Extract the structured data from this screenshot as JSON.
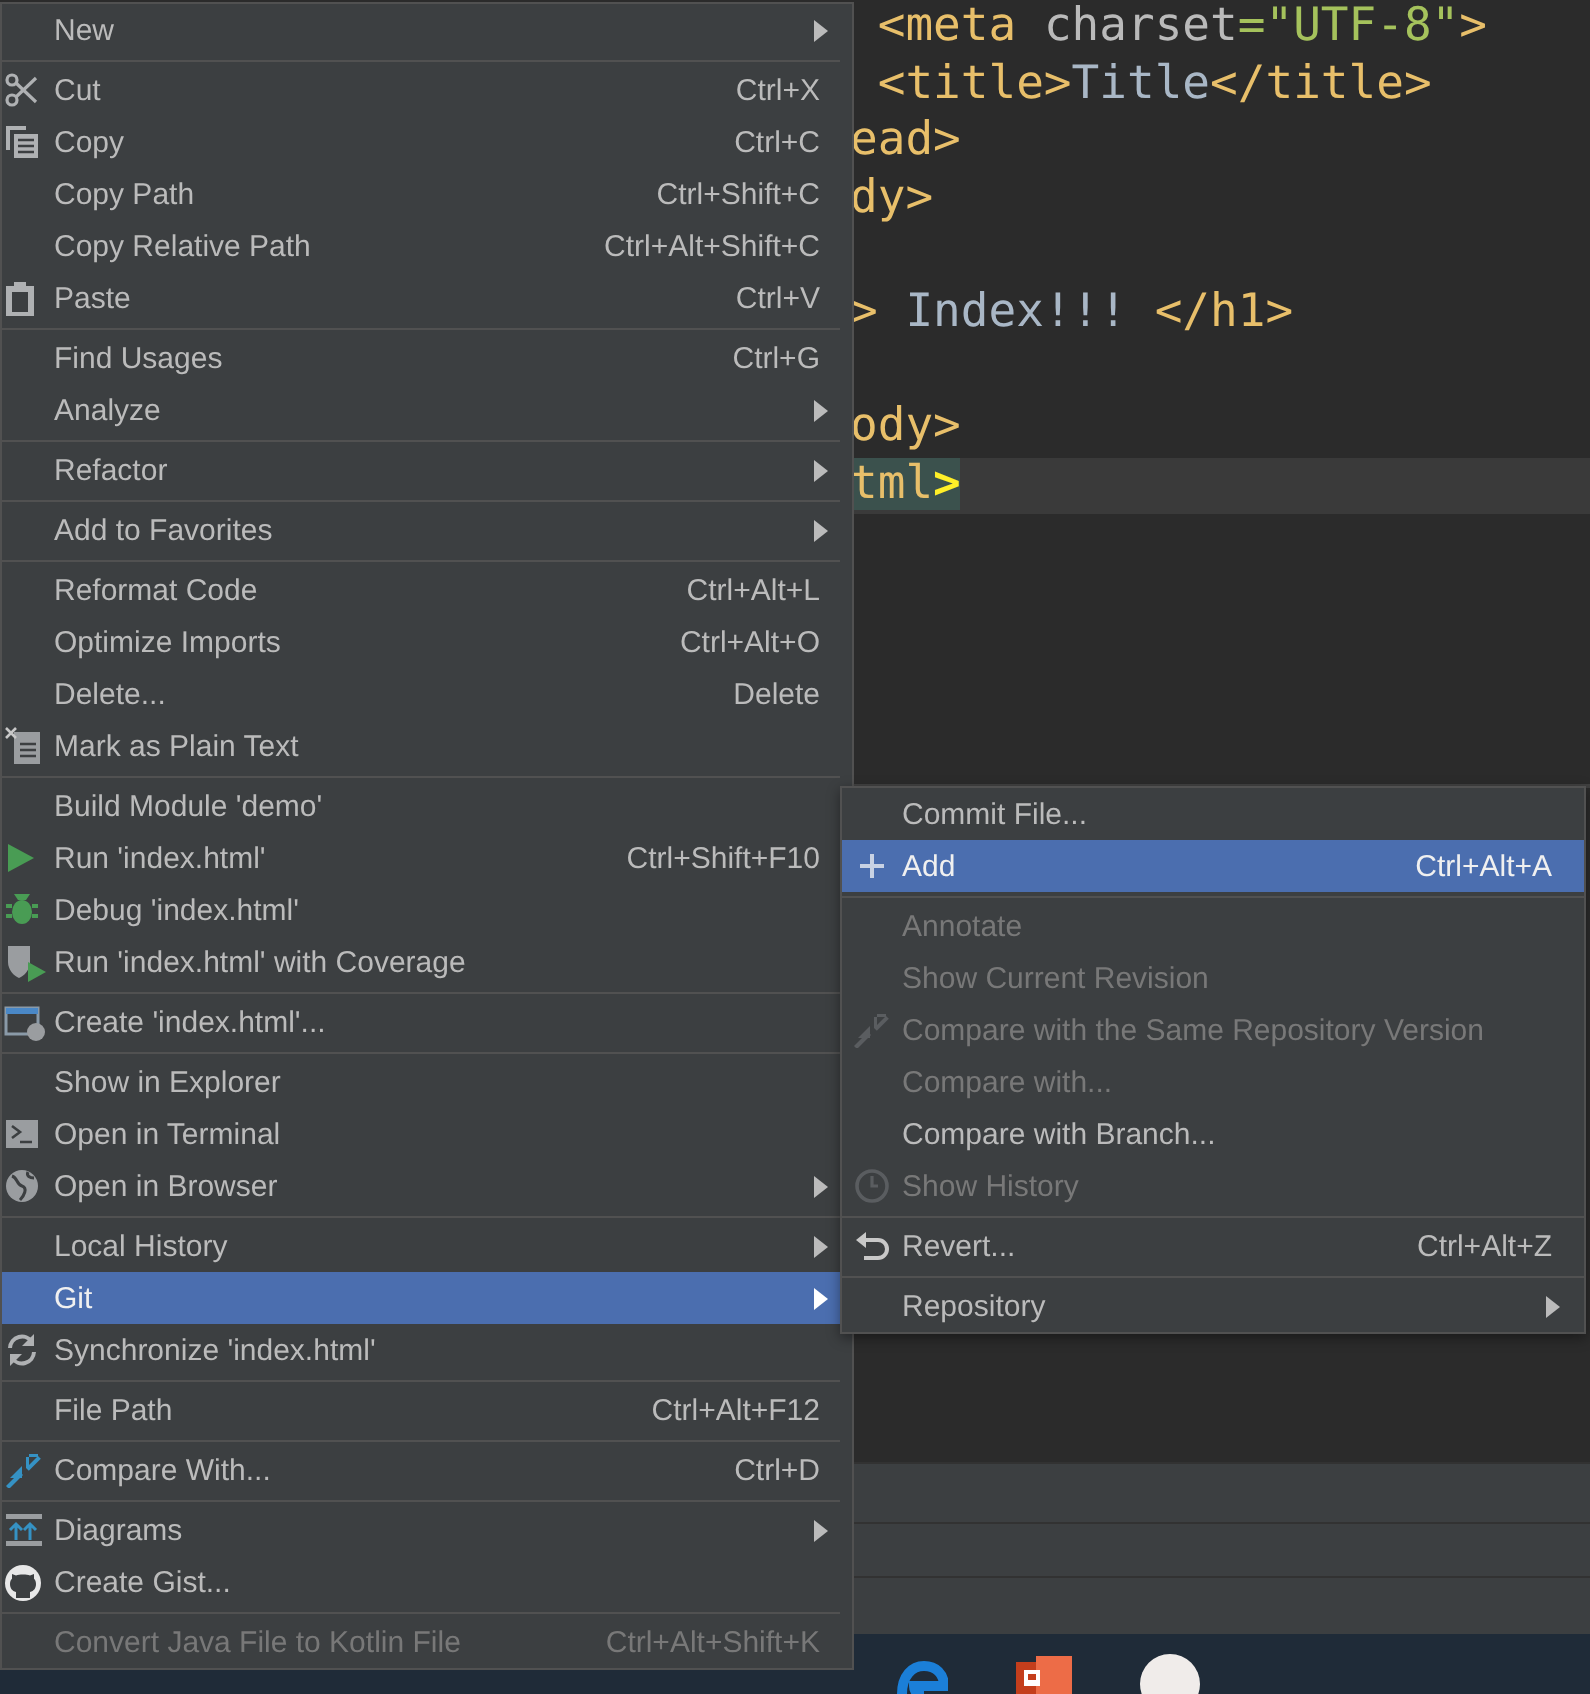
{
  "editor": {
    "lines": [
      {
        "kind": "code",
        "current": false,
        "segments": [
          {
            "text": " <meta ",
            "kind": "tag"
          },
          {
            "text": "charset",
            "kind": "attr"
          },
          {
            "text": "=\"UTF-8\"",
            "kind": "string"
          },
          {
            "text": ">",
            "kind": "tag"
          }
        ]
      },
      {
        "kind": "code",
        "current": false,
        "segments": [
          {
            "text": " <title>",
            "kind": "tag"
          },
          {
            "text": "Title",
            "kind": "text"
          },
          {
            "text": "</title>",
            "kind": "tag"
          }
        ]
      },
      {
        "kind": "code",
        "current": false,
        "segments": [
          {
            "text": "ead>",
            "kind": "tag"
          }
        ]
      },
      {
        "kind": "code",
        "current": false,
        "segments": [
          {
            "text": "dy>",
            "kind": "tag"
          }
        ]
      },
      {
        "kind": "blank"
      },
      {
        "kind": "code",
        "current": false,
        "segments": [
          {
            "text": "> ",
            "kind": "tag"
          },
          {
            "text": "Index!!! ",
            "kind": "text"
          },
          {
            "text": "</h1>",
            "kind": "tag"
          }
        ]
      },
      {
        "kind": "blank"
      },
      {
        "kind": "code",
        "current": false,
        "segments": [
          {
            "text": "ody>",
            "kind": "tag"
          }
        ]
      },
      {
        "kind": "code",
        "current": true,
        "segments": [
          {
            "text": "tml",
            "kind": "match_tag"
          },
          {
            "text": ">",
            "kind": "match_bracket"
          }
        ]
      }
    ]
  },
  "context_menu": {
    "items": [
      {
        "kind": "item",
        "label": "New",
        "has_submenu": true,
        "selected": false,
        "disabled": false
      },
      {
        "kind": "separator"
      },
      {
        "kind": "item",
        "label": "Cut",
        "shortcut": "Ctrl+X",
        "has_submenu": false,
        "selected": false,
        "disabled": false
      },
      {
        "kind": "item",
        "label": "Copy",
        "shortcut": "Ctrl+C",
        "has_submenu": false,
        "selected": false,
        "disabled": false
      },
      {
        "kind": "item",
        "label": "Copy Path",
        "shortcut": "Ctrl+Shift+C",
        "has_submenu": false,
        "selected": false,
        "disabled": false
      },
      {
        "kind": "item",
        "label": "Copy Relative Path",
        "shortcut": "Ctrl+Alt+Shift+C",
        "has_submenu": false,
        "selected": false,
        "disabled": false
      },
      {
        "kind": "item",
        "label": "Paste",
        "shortcut": "Ctrl+V",
        "has_submenu": false,
        "selected": false,
        "disabled": false
      },
      {
        "kind": "separator"
      },
      {
        "kind": "item",
        "label": "Find Usages",
        "shortcut": "Ctrl+G",
        "has_submenu": false,
        "selected": false,
        "disabled": false
      },
      {
        "kind": "item",
        "label": "Analyze",
        "has_submenu": true,
        "selected": false,
        "disabled": false
      },
      {
        "kind": "separator"
      },
      {
        "kind": "item",
        "label": "Refactor",
        "has_submenu": true,
        "selected": false,
        "disabled": false
      },
      {
        "kind": "separator"
      },
      {
        "kind": "item",
        "label": "Add to Favorites",
        "has_submenu": true,
        "selected": false,
        "disabled": false
      },
      {
        "kind": "separator"
      },
      {
        "kind": "item",
        "label": "Reformat Code",
        "shortcut": "Ctrl+Alt+L",
        "has_submenu": false,
        "selected": false,
        "disabled": false
      },
      {
        "kind": "item",
        "label": "Optimize Imports",
        "shortcut": "Ctrl+Alt+O",
        "has_submenu": false,
        "selected": false,
        "disabled": false
      },
      {
        "kind": "item",
        "label": "Delete...",
        "shortcut": "Delete",
        "has_submenu": false,
        "selected": false,
        "disabled": false
      },
      {
        "kind": "item",
        "label": "Mark as Plain Text",
        "has_submenu": false,
        "selected": false,
        "disabled": false
      },
      {
        "kind": "separator"
      },
      {
        "kind": "item",
        "label": "Build Module 'demo'",
        "has_submenu": false,
        "selected": false,
        "disabled": false
      },
      {
        "kind": "item",
        "label": "Run 'index.html'",
        "shortcut": "Ctrl+Shift+F10",
        "has_submenu": false,
        "selected": false,
        "disabled": false
      },
      {
        "kind": "item",
        "label": "Debug 'index.html'",
        "has_submenu": false,
        "selected": false,
        "disabled": false
      },
      {
        "kind": "item",
        "label": "Run 'index.html' with Coverage",
        "has_submenu": false,
        "selected": false,
        "disabled": false
      },
      {
        "kind": "separator"
      },
      {
        "kind": "item",
        "label": "Create 'index.html'...",
        "has_submenu": false,
        "selected": false,
        "disabled": false
      },
      {
        "kind": "separator"
      },
      {
        "kind": "item",
        "label": "Show in Explorer",
        "has_submenu": false,
        "selected": false,
        "disabled": false
      },
      {
        "kind": "item",
        "label": "Open in Terminal",
        "has_submenu": false,
        "selected": false,
        "disabled": false
      },
      {
        "kind": "item",
        "label": "Open in Browser",
        "has_submenu": true,
        "selected": false,
        "disabled": false
      },
      {
        "kind": "separator"
      },
      {
        "kind": "item",
        "label": "Local History",
        "has_submenu": true,
        "selected": false,
        "disabled": false
      },
      {
        "kind": "item",
        "label": "Git",
        "has_submenu": true,
        "selected": true,
        "disabled": false
      },
      {
        "kind": "item",
        "label": "Synchronize 'index.html'",
        "has_submenu": false,
        "selected": false,
        "disabled": false
      },
      {
        "kind": "separator"
      },
      {
        "kind": "item",
        "label": "File Path",
        "shortcut": "Ctrl+Alt+F12",
        "has_submenu": false,
        "selected": false,
        "disabled": false
      },
      {
        "kind": "separator"
      },
      {
        "kind": "item",
        "label": "Compare With...",
        "shortcut": "Ctrl+D",
        "has_submenu": false,
        "selected": false,
        "disabled": false
      },
      {
        "kind": "separator"
      },
      {
        "kind": "item",
        "label": "Diagrams",
        "has_submenu": true,
        "selected": false,
        "disabled": false
      },
      {
        "kind": "item",
        "label": "Create Gist...",
        "has_submenu": false,
        "selected": false,
        "disabled": false
      },
      {
        "kind": "separator"
      },
      {
        "kind": "item",
        "label": "Convert Java File to Kotlin File",
        "shortcut": "Ctrl+Alt+Shift+K",
        "has_submenu": false,
        "selected": false,
        "disabled": true
      }
    ]
  },
  "git_submenu": {
    "items": [
      {
        "kind": "item",
        "label": "Commit File...",
        "has_submenu": false,
        "selected": false,
        "disabled": false
      },
      {
        "kind": "item",
        "label": "Add",
        "shortcut": "Ctrl+Alt+A",
        "has_submenu": false,
        "selected": true,
        "disabled": false
      },
      {
        "kind": "separator"
      },
      {
        "kind": "item",
        "label": "Annotate",
        "has_submenu": false,
        "selected": false,
        "disabled": true
      },
      {
        "kind": "item",
        "label": "Show Current Revision",
        "has_submenu": false,
        "selected": false,
        "disabled": true
      },
      {
        "kind": "item",
        "label": "Compare with the Same Repository Version",
        "has_submenu": false,
        "selected": false,
        "disabled": true
      },
      {
        "kind": "item",
        "label": "Compare with...",
        "has_submenu": false,
        "selected": false,
        "disabled": true
      },
      {
        "kind": "item",
        "label": "Compare with Branch...",
        "has_submenu": false,
        "selected": false,
        "disabled": false
      },
      {
        "kind": "item",
        "label": "Show History",
        "has_submenu": false,
        "selected": false,
        "disabled": true
      },
      {
        "kind": "separator"
      },
      {
        "kind": "item",
        "label": "Revert...",
        "shortcut": "Ctrl+Alt+Z",
        "has_submenu": false,
        "selected": false,
        "disabled": false
      },
      {
        "kind": "separator"
      },
      {
        "kind": "item",
        "label": "Repository",
        "has_submenu": true,
        "selected": false,
        "disabled": false
      }
    ]
  }
}
